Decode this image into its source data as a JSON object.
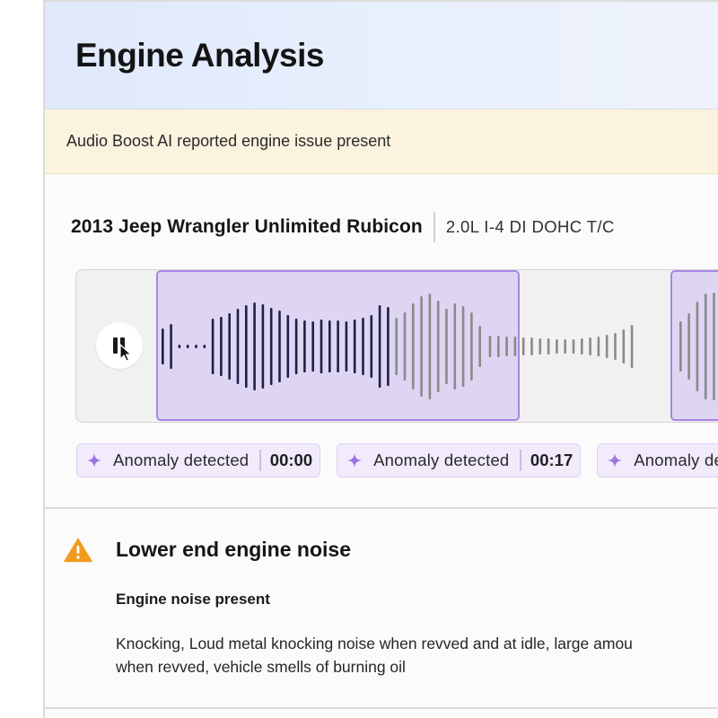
{
  "header": {
    "title": "Engine Analysis"
  },
  "alert": {
    "text": "Audio Boost AI reported engine issue present"
  },
  "vehicle": {
    "name": "2013 Jeep Wrangler Unlimited Rubicon",
    "engine": "2.0L I-4 DI DOHC T/C"
  },
  "player": {
    "state": "playing",
    "button_icon": "pause-icon",
    "accent_color": "#a787e3"
  },
  "anomalies": [
    {
      "label": "Anomaly detected",
      "time": "00:00"
    },
    {
      "label": "Anomaly detected",
      "time": "00:17"
    },
    {
      "label": "Anomaly detected",
      "time": ""
    }
  ],
  "issue": {
    "icon": "warning-icon",
    "title": "Lower end engine noise",
    "subtitle": "Engine noise present",
    "description_line1": "Knocking, Loud metal knocking noise when revved and at idle, large amou",
    "description_line2": "when revved, vehicle smells of burning oil"
  },
  "colors": {
    "header_bg": "#dfe9fb",
    "alert_bg": "#fcf3de",
    "anomaly_bg": "#f1ebfc",
    "warning": "#f29c1f",
    "wave_highlight": "#1e1f4a",
    "wave_normal": "#8a8a8a"
  }
}
